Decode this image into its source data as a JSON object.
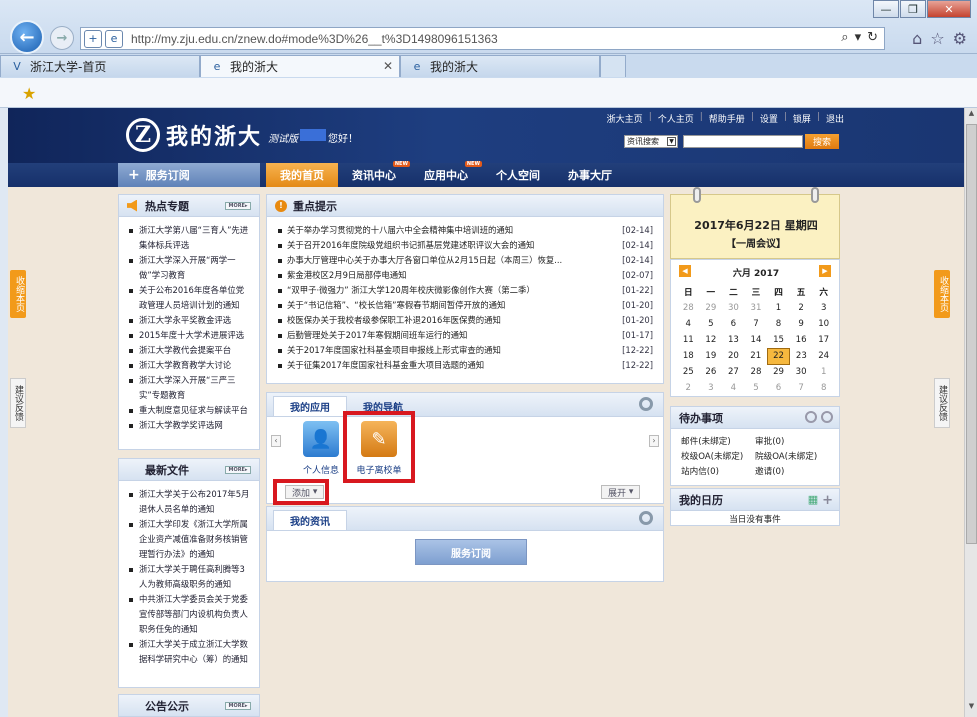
{
  "browser": {
    "url": "http://my.zju.edu.cn/znew.do#mode%3D%26__t%3D1498096151363",
    "tabs": [
      {
        "label": "浙江大学-首页",
        "icon": "V"
      },
      {
        "label": "我的浙大",
        "icon": "e"
      },
      {
        "label": "我的浙大",
        "icon": "e"
      }
    ],
    "window_buttons": [
      "—",
      "❐",
      "✕"
    ]
  },
  "header": {
    "logo_text": "我的浙大",
    "beta_label": "测试版",
    "greeting": "您好！",
    "top_links": [
      "浙大主页",
      "个人主页",
      "帮助手册",
      "设置",
      "锁屏",
      "退出"
    ],
    "search_select": "资讯搜索",
    "search_button": "搜索"
  },
  "nav": {
    "service_subscribe": "服务订阅",
    "items": [
      {
        "label": "我的首页"
      },
      {
        "label": "资讯中心",
        "badge": "NEW"
      },
      {
        "label": "应用中心",
        "badge": "NEW"
      },
      {
        "label": "个人空间"
      },
      {
        "label": "办事大厅"
      }
    ]
  },
  "side_tabs": {
    "collapse": "收缩本页",
    "feedback": "建议反馈"
  },
  "hot_topics": {
    "title": "热点专题",
    "more": "MORE▸",
    "items": [
      "浙江大学第八届“三育人”先进集体标兵评选",
      "浙江大学深入开展“两学一做”学习教育",
      "关于公布2016年度各单位党政管理人员培训计划的通知",
      "浙江大学永平奖教金评选",
      "2015年度十大学术进展评选",
      "浙江大学教代会提案平台",
      "浙江大学教育教学大讨论",
      "浙江大学深入开展“三严三实”专题教育",
      "重大制度意见征求与解读平台",
      "浙江大学教学奖评选网"
    ]
  },
  "latest_files": {
    "title": "最新文件",
    "more": "MORE▸",
    "items": [
      "浙江大学关于公布2017年5月退休人员名单的通知",
      "浙江大学印发《浙江大学所属企业资产减值准备财务核销管理暂行办法》的通知",
      "浙江大学关于聘任高利腾等3人为教师高级职务的通知",
      "中共浙江大学委员会关于党委宣传部等部门内设机构负责人职务任免的通知",
      "浙江大学关于成立浙江大学数据科学研究中心（筹）的通知"
    ]
  },
  "announcements": {
    "title": "公告公示",
    "more": "MORE▸"
  },
  "key_notices": {
    "title": "重点提示",
    "items": [
      {
        "text": "关于举办学习贯彻党的十八届六中全会精神集中培训班的通知",
        "date": "[02-14]"
      },
      {
        "text": "关于召开2016年度院级党组织书记抓基层党建述职评议大会的通知",
        "date": "[02-14]"
      },
      {
        "text": "办事大厅管理中心关于办事大厅各窗口单位从2月15日起（本周三）恢复...",
        "date": "[02-14]"
      },
      {
        "text": "紫金港校区2月9日局部停电通知",
        "date": "[02-07]"
      },
      {
        "text": "“双甲子·微强力” 浙江大学120周年校庆微影像创作大赛（第二季）",
        "date": "[01-22]"
      },
      {
        "text": "关于“书记信箱”、“校长信箱”寒假春节期间暂停开放的通知",
        "date": "[01-20]"
      },
      {
        "text": "校医保办关于我校者级参保职工补退2016年医保费的通知",
        "date": "[01-20]"
      },
      {
        "text": "后勤管理处关于2017年寒假期间班车运行的通知",
        "date": "[01-17]"
      },
      {
        "text": "关于2017年度国家社科基金项目申报线上形式审查的通知",
        "date": "[12-22]"
      },
      {
        "text": "关于征集2017年度国家社科基金重大项目选题的通知",
        "date": "[12-22]"
      }
    ]
  },
  "apps": {
    "tabs": [
      "我的应用",
      "我的导航"
    ],
    "items": [
      {
        "label": "个人信息"
      },
      {
        "label": "电子离校单"
      }
    ],
    "add_button": "添加",
    "expand_button": "展开"
  },
  "my_news": {
    "title": "我的资讯",
    "subscribe_button": "服务订阅"
  },
  "calendar": {
    "date_title": "2017年6月22日 星期四",
    "event_title": "【一周会议】",
    "month_label": "六月 2017",
    "weekdays": [
      "日",
      "一",
      "二",
      "三",
      "四",
      "五",
      "六"
    ],
    "weeks": [
      [
        {
          "d": "28",
          "o": true
        },
        {
          "d": "29",
          "o": true
        },
        {
          "d": "30",
          "o": true
        },
        {
          "d": "31",
          "o": true
        },
        {
          "d": "1"
        },
        {
          "d": "2"
        },
        {
          "d": "3"
        }
      ],
      [
        {
          "d": "4"
        },
        {
          "d": "5"
        },
        {
          "d": "6"
        },
        {
          "d": "7"
        },
        {
          "d": "8"
        },
        {
          "d": "9"
        },
        {
          "d": "10"
        }
      ],
      [
        {
          "d": "11"
        },
        {
          "d": "12"
        },
        {
          "d": "13"
        },
        {
          "d": "14"
        },
        {
          "d": "15"
        },
        {
          "d": "16"
        },
        {
          "d": "17"
        }
      ],
      [
        {
          "d": "18"
        },
        {
          "d": "19"
        },
        {
          "d": "20"
        },
        {
          "d": "21"
        },
        {
          "d": "22",
          "t": true
        },
        {
          "d": "23"
        },
        {
          "d": "24"
        }
      ],
      [
        {
          "d": "25"
        },
        {
          "d": "26"
        },
        {
          "d": "27"
        },
        {
          "d": "28"
        },
        {
          "d": "29"
        },
        {
          "d": "30"
        },
        {
          "d": "1",
          "o": true
        }
      ],
      [
        {
          "d": "2",
          "o": true
        },
        {
          "d": "3",
          "o": true
        },
        {
          "d": "4",
          "o": true
        },
        {
          "d": "5",
          "o": true
        },
        {
          "d": "6",
          "o": true
        },
        {
          "d": "7",
          "o": true
        },
        {
          "d": "8",
          "o": true
        }
      ]
    ]
  },
  "todo": {
    "title": "待办事项",
    "items": [
      "邮件(未绑定)",
      "审批(0)",
      "校级OA(未绑定)",
      "院级OA(未绑定)",
      "站内信(0)",
      "邀请(0)"
    ]
  },
  "diary": {
    "title": "我的日历",
    "empty": "当日没有事件"
  },
  "colors": {
    "header_navy": "#1e3e80",
    "accent_orange": "#e48a16",
    "highlight_red": "#d8181f"
  }
}
